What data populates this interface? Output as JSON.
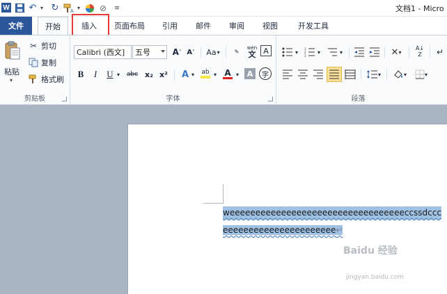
{
  "titlebar": {
    "app_icon": "word-icon",
    "app_letter": "W",
    "doc_title": "文档1 - Micro",
    "quick_access": [
      "save-icon",
      "undo-icon",
      "redo-icon",
      "format-painter-icon",
      "color-circle-icon",
      "clear-icon",
      "customize-icon"
    ]
  },
  "tabs": {
    "file": "文件",
    "home": "开始",
    "insert": "插入",
    "layout": "页面布局",
    "references": "引用",
    "mailings": "邮件",
    "review": "审阅",
    "view": "视图",
    "developer": "开发工具"
  },
  "clipboard": {
    "paste": "粘贴",
    "cut": "剪切",
    "copy": "复制",
    "format_painter": "格式刷",
    "label": "剪贴板"
  },
  "font": {
    "name": "Calibri (西文]",
    "size": "五号",
    "label": "字体",
    "bold": "B",
    "italic": "I",
    "underline": "U",
    "strike": "abc",
    "subscript": "x₂",
    "superscript": "x²",
    "grow": "A",
    "shrink": "A",
    "case": "Aa",
    "font_color_letter": "A",
    "highlight_letter": "ab",
    "phonetic": "wén",
    "char_border": "A",
    "char_shading": "A",
    "enclose": "字",
    "clear_format": "A"
  },
  "paragraph": {
    "label": "段落"
  },
  "document": {
    "line1": "weeeeeeeeeeeeeeeeeeeeeeeeeeeeeeeeeeccssdccc",
    "line2": "eeeeeeeeeeeeeeeeeeeeee"
  },
  "watermark": {
    "brand": "Baidu 经验",
    "url": "jingyan.baidu.com"
  },
  "colors": {
    "file_tab": "#2b579a",
    "highlight_box": "#e53935",
    "selection": "#9fc1e4",
    "workspace": "#aab4c3"
  }
}
